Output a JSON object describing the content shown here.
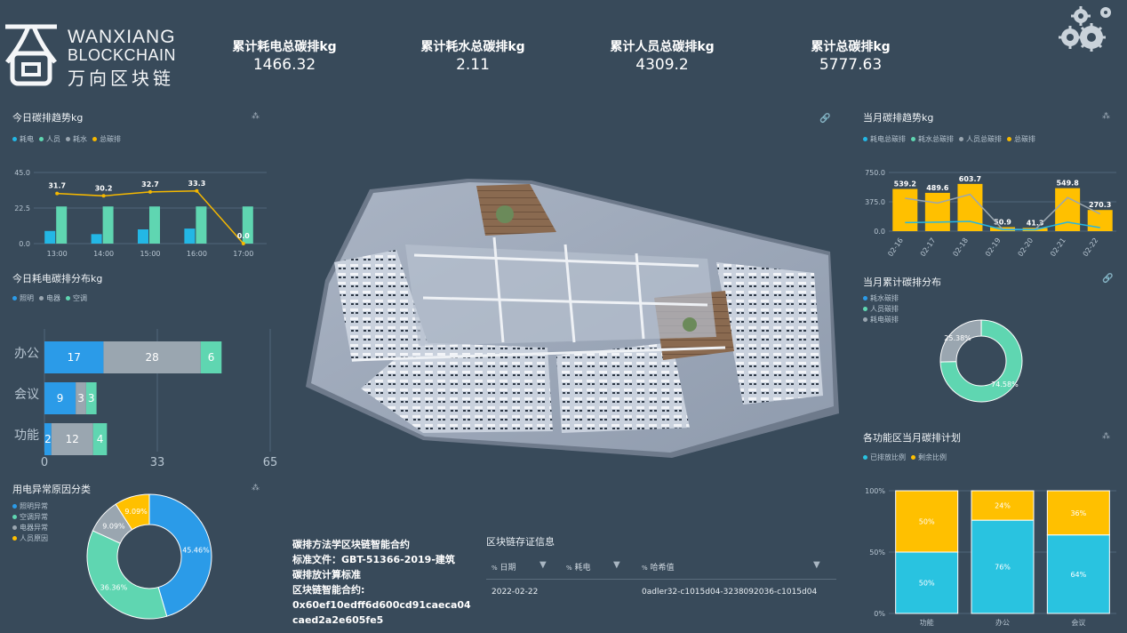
{
  "brand": {
    "line1": "WANXIANG",
    "line2": "BLOCKCHAIN",
    "line3": "万向区块链"
  },
  "stats": [
    {
      "label": "累计耗电总碳排kg",
      "value": "1466.32"
    },
    {
      "label": "累计耗水总碳排kg",
      "value": "2.11"
    },
    {
      "label": "累计人员总碳排kg",
      "value": "4309.2"
    },
    {
      "label": "累计总碳排kg",
      "value": "5777.63"
    }
  ],
  "colors": {
    "electric": "#23b7e5",
    "person": "#5fd6b1",
    "water": "#9aa6b0",
    "total": "#f5b800",
    "blue": "#2b9be8",
    "yellow": "#ffc000",
    "cyan": "#29c3e0"
  },
  "today_trend": {
    "title": "今日碳排趋势kg",
    "legend": [
      "耗电",
      "人员",
      "耗水",
      "总碳排"
    ]
  },
  "today_electric": {
    "title": "今日耗电碳排分布kg",
    "legend": [
      "照明",
      "电器",
      "空调"
    ]
  },
  "abnormal": {
    "title": "用电异常原因分类",
    "legend": [
      "照明异常",
      "空调异常",
      "电器异常",
      "人员原因"
    ]
  },
  "month_trend": {
    "title": "当月碳排趋势kg",
    "legend": [
      "耗电总碳排",
      "耗水总碳排",
      "人员总碳排",
      "总碳排"
    ]
  },
  "month_dist": {
    "title": "当月累计碳排分布",
    "legend": [
      "耗水碳排",
      "人员碳排",
      "耗电碳排"
    ]
  },
  "plan": {
    "title": "各功能区当月碳排计划",
    "legend": [
      "已排放比例",
      "剩余比例"
    ]
  },
  "contract": {
    "line1": "碳排方法学区块链智能合约",
    "line2": "标准文件：GBT-51366-2019-建筑",
    "line3": "碳排放计算标准",
    "line4": "区块链智能合约:",
    "line5": "0x60ef10edff6d600cd91caeca04",
    "line6": "caed2a2e605fe5"
  },
  "chain": {
    "title": "区块链存证信息",
    "col_date": "日期",
    "col_power": "耗电",
    "col_hash": "哈希值",
    "row_date": "2022-02-22",
    "row_hash": "0adler32-c1015d04-3238092036-c1015d04",
    "col_prefix": "%"
  },
  "chart_data": [
    {
      "id": "today_trend",
      "type": "bar",
      "categories": [
        "13:00",
        "14:00",
        "15:00",
        "16:00",
        "17:00"
      ],
      "series": [
        {
          "name": "耗电",
          "type": "bar",
          "values": [
            8,
            6,
            9,
            9.5,
            0
          ]
        },
        {
          "name": "人员",
          "type": "bar",
          "values": [
            23.5,
            23.5,
            23.5,
            23.5,
            23.5
          ]
        },
        {
          "name": "总碳排",
          "type": "line",
          "values": [
            31.7,
            30.2,
            32.7,
            33.3,
            0.0
          ]
        }
      ],
      "ylim": [
        0,
        45
      ],
      "yticks": [
        "0.0",
        "22.5",
        "45.0"
      ],
      "title": "今日碳排趋势kg"
    },
    {
      "id": "today_electric",
      "type": "bar",
      "orientation": "horizontal",
      "stacked": true,
      "categories": [
        "办公",
        "会议",
        "功能"
      ],
      "series": [
        {
          "name": "照明",
          "values": [
            17,
            9,
            2
          ]
        },
        {
          "name": "电器",
          "values": [
            28,
            3,
            12
          ]
        },
        {
          "name": "空调",
          "values": [
            6,
            3,
            4
          ]
        }
      ],
      "xlim": [
        0,
        65
      ],
      "xticks": [
        "0",
        "33",
        "65"
      ],
      "title": "今日耗电碳排分布kg"
    },
    {
      "id": "abnormal",
      "type": "pie",
      "labels": [
        "照明异常",
        "空调异常",
        "电器异常",
        "人员原因"
      ],
      "values": [
        45.46,
        36.36,
        9.09,
        9.09
      ],
      "value_labels": [
        "45.46%",
        "36.36%",
        "9.09%",
        "9.09%"
      ],
      "title": "用电异常原因分类"
    },
    {
      "id": "month_trend",
      "type": "bar",
      "categories": [
        "02-16",
        "02-17",
        "02-18",
        "02-19",
        "02-20",
        "02-21",
        "02-22"
      ],
      "series": [
        {
          "name": "总碳排",
          "type": "bar",
          "values": [
            539.2,
            489.6,
            603.7,
            50.9,
            41.3,
            549.8,
            270.3
          ]
        },
        {
          "name": "人员总碳排",
          "type": "line",
          "values": [
            420,
            360,
            470,
            25,
            20,
            430,
            220
          ]
        },
        {
          "name": "耗电总碳排",
          "type": "line",
          "values": [
            110,
            115,
            125,
            20,
            18,
            115,
            45
          ]
        }
      ],
      "ylim": [
        0,
        750
      ],
      "yticks": [
        "0.0",
        "375.0",
        "750.0"
      ],
      "value_labels": [
        "539.2",
        "489.6",
        "603.7",
        "50.9",
        "41.3",
        "549.8",
        "270.3"
      ],
      "title": "当月碳排趋势kg"
    },
    {
      "id": "month_dist",
      "type": "pie",
      "labels": [
        "耗水碳排",
        "人员碳排",
        "耗电碳排"
      ],
      "values": [
        0.04,
        74.58,
        25.38
      ],
      "value_labels": [
        "0.04%",
        "74.58%",
        "25.38%"
      ],
      "title": "当月累计碳排分布"
    },
    {
      "id": "plan",
      "type": "bar",
      "stacked": true,
      "categories": [
        "功能",
        "办公",
        "会议"
      ],
      "series": [
        {
          "name": "已排放比例",
          "values": [
            50,
            76,
            64
          ]
        },
        {
          "name": "剩余比例",
          "values": [
            50,
            24,
            36
          ]
        }
      ],
      "ylim": [
        0,
        100
      ],
      "yticks": [
        "0%",
        "50%",
        "100%"
      ],
      "title": "各功能区当月碳排计划"
    }
  ]
}
